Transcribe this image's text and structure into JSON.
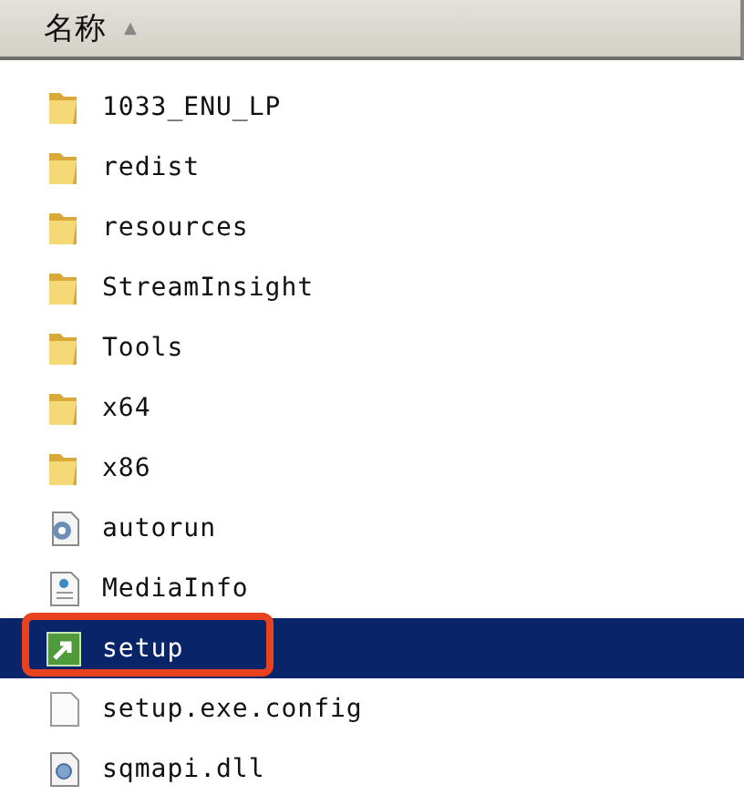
{
  "column_header": {
    "label": "名称",
    "sort_arrow": "▲"
  },
  "files": [
    {
      "name": "1033_ENU_LP",
      "kind": "folder",
      "selected": false,
      "highlighted": false
    },
    {
      "name": "redist",
      "kind": "folder",
      "selected": false,
      "highlighted": false
    },
    {
      "name": "resources",
      "kind": "folder",
      "selected": false,
      "highlighted": false
    },
    {
      "name": "StreamInsight",
      "kind": "folder",
      "selected": false,
      "highlighted": false
    },
    {
      "name": "Tools",
      "kind": "folder",
      "selected": false,
      "highlighted": false
    },
    {
      "name": "x64",
      "kind": "folder",
      "selected": false,
      "highlighted": false
    },
    {
      "name": "x86",
      "kind": "folder",
      "selected": false,
      "highlighted": false
    },
    {
      "name": "autorun",
      "kind": "settings",
      "selected": false,
      "highlighted": false
    },
    {
      "name": "MediaInfo",
      "kind": "markup",
      "selected": false,
      "highlighted": false
    },
    {
      "name": "setup",
      "kind": "app",
      "selected": true,
      "highlighted": true
    },
    {
      "name": "setup.exe.config",
      "kind": "blank",
      "selected": false,
      "highlighted": false
    },
    {
      "name": "sqmapi.dll",
      "kind": "library",
      "selected": false,
      "highlighted": false
    }
  ]
}
